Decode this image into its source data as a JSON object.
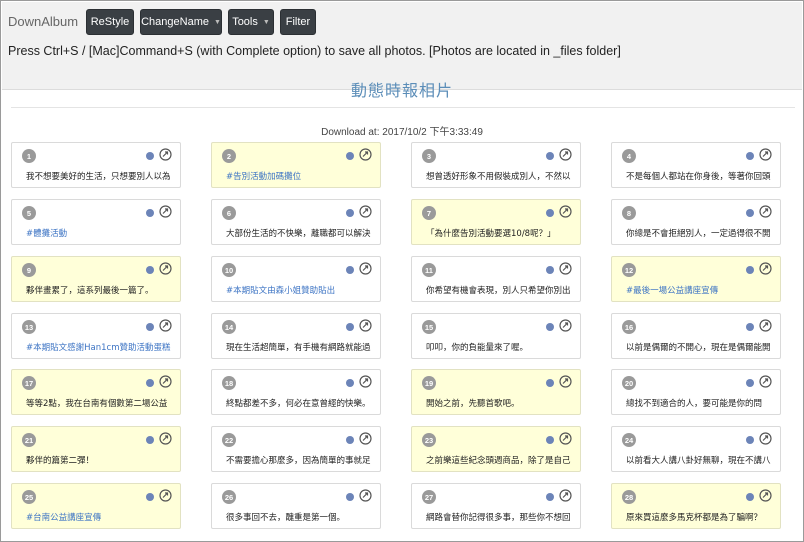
{
  "app": {
    "brand": "DownAlbum"
  },
  "toolbar": {
    "restyle": "ReStyle",
    "changename": "ChangeName",
    "tools": "Tools",
    "filter": "Filter",
    "caret": "▼"
  },
  "hint": "Press Ctrl+S / [Mac]Command+S (with Complete option) to save all photos. [Photos are located in _files folder]",
  "page": {
    "title": "動態時報相片",
    "download_at": "Download at: 2017/10/2 下午3:33:49"
  },
  "cards": [
    {
      "n": "1",
      "text": "我不想要美好的生活，只想要別人以為",
      "style": "white",
      "link": false
    },
    {
      "n": "2",
      "text": "#告別活動加碼攤位",
      "style": "yellow",
      "link": true
    },
    {
      "n": "3",
      "text": "想曾透好形象不用假裝成別人，不然以",
      "style": "white",
      "link": false
    },
    {
      "n": "4",
      "text": "不是每個人都站在你身後，等著你回頭",
      "style": "white",
      "link": false
    },
    {
      "n": "5",
      "text": "#體攤活動",
      "style": "white",
      "link": true
    },
    {
      "n": "6",
      "text": "大部份生活的不快樂，離職都可以解決",
      "style": "white",
      "link": false
    },
    {
      "n": "7",
      "text": "「為什麼告別活動要選10/8呢？」",
      "style": "yellow",
      "link": false
    },
    {
      "n": "8",
      "text": "你總是不會拒絕別人，一定過得很不開",
      "style": "white",
      "link": false
    },
    {
      "n": "9",
      "text": "夥伴畫累了，這系列最後一篇了。",
      "style": "yellow",
      "link": false
    },
    {
      "n": "10",
      "text": "#本期貼文由森小姐贊助貼出",
      "style": "white",
      "link": true
    },
    {
      "n": "11",
      "text": "你希望有機會表現，別人只希望你別出",
      "style": "white",
      "link": false
    },
    {
      "n": "12",
      "text": "#最後一場公益講座宣傳",
      "style": "yellow",
      "link": true
    },
    {
      "n": "13",
      "text": "#本期貼文感謝Han1cm贊助活動蛋糕",
      "style": "white",
      "link": true
    },
    {
      "n": "14",
      "text": "現在生活超簡單，有手機有網路就能過",
      "style": "white",
      "link": false
    },
    {
      "n": "15",
      "text": "叩叩，你的負能量來了喔。",
      "style": "white",
      "link": false
    },
    {
      "n": "16",
      "text": "以前是偶爾的不開心，現在是偶爾能開",
      "style": "white",
      "link": false
    },
    {
      "n": "17",
      "text": "等等2點，我在台南有個數第二場公益",
      "style": "yellow",
      "link": false
    },
    {
      "n": "18",
      "text": "終點都差不多，何必在意曾經的快樂。",
      "style": "white",
      "link": false
    },
    {
      "n": "19",
      "text": "開始之前，先聽首歌吧。",
      "style": "yellow",
      "link": false
    },
    {
      "n": "20",
      "text": "總找不到適合的人，要可能是你的問",
      "style": "white",
      "link": false
    },
    {
      "n": "21",
      "text": "夥伴的篇第二彈！",
      "style": "yellow",
      "link": false
    },
    {
      "n": "22",
      "text": "不需要擔心那麼多，因為簡單的事就足",
      "style": "white",
      "link": false
    },
    {
      "n": "23",
      "text": "之前樂這些紀念頭週商品，除了是自己",
      "style": "yellow",
      "link": false
    },
    {
      "n": "24",
      "text": "以前看大人講八卦好無聊，現在不講八",
      "style": "white",
      "link": false
    },
    {
      "n": "25",
      "text": "#台南公益講座宣傳",
      "style": "yellow",
      "link": true
    },
    {
      "n": "26",
      "text": "很多事回不去，醜重是第一個。",
      "style": "white",
      "link": false
    },
    {
      "n": "27",
      "text": "網路會替你記得很多事，那些你不想回",
      "style": "white",
      "link": false
    },
    {
      "n": "28",
      "text": "原來買這麼多馬克杯都是為了騙啊？",
      "style": "yellow",
      "link": false
    }
  ]
}
